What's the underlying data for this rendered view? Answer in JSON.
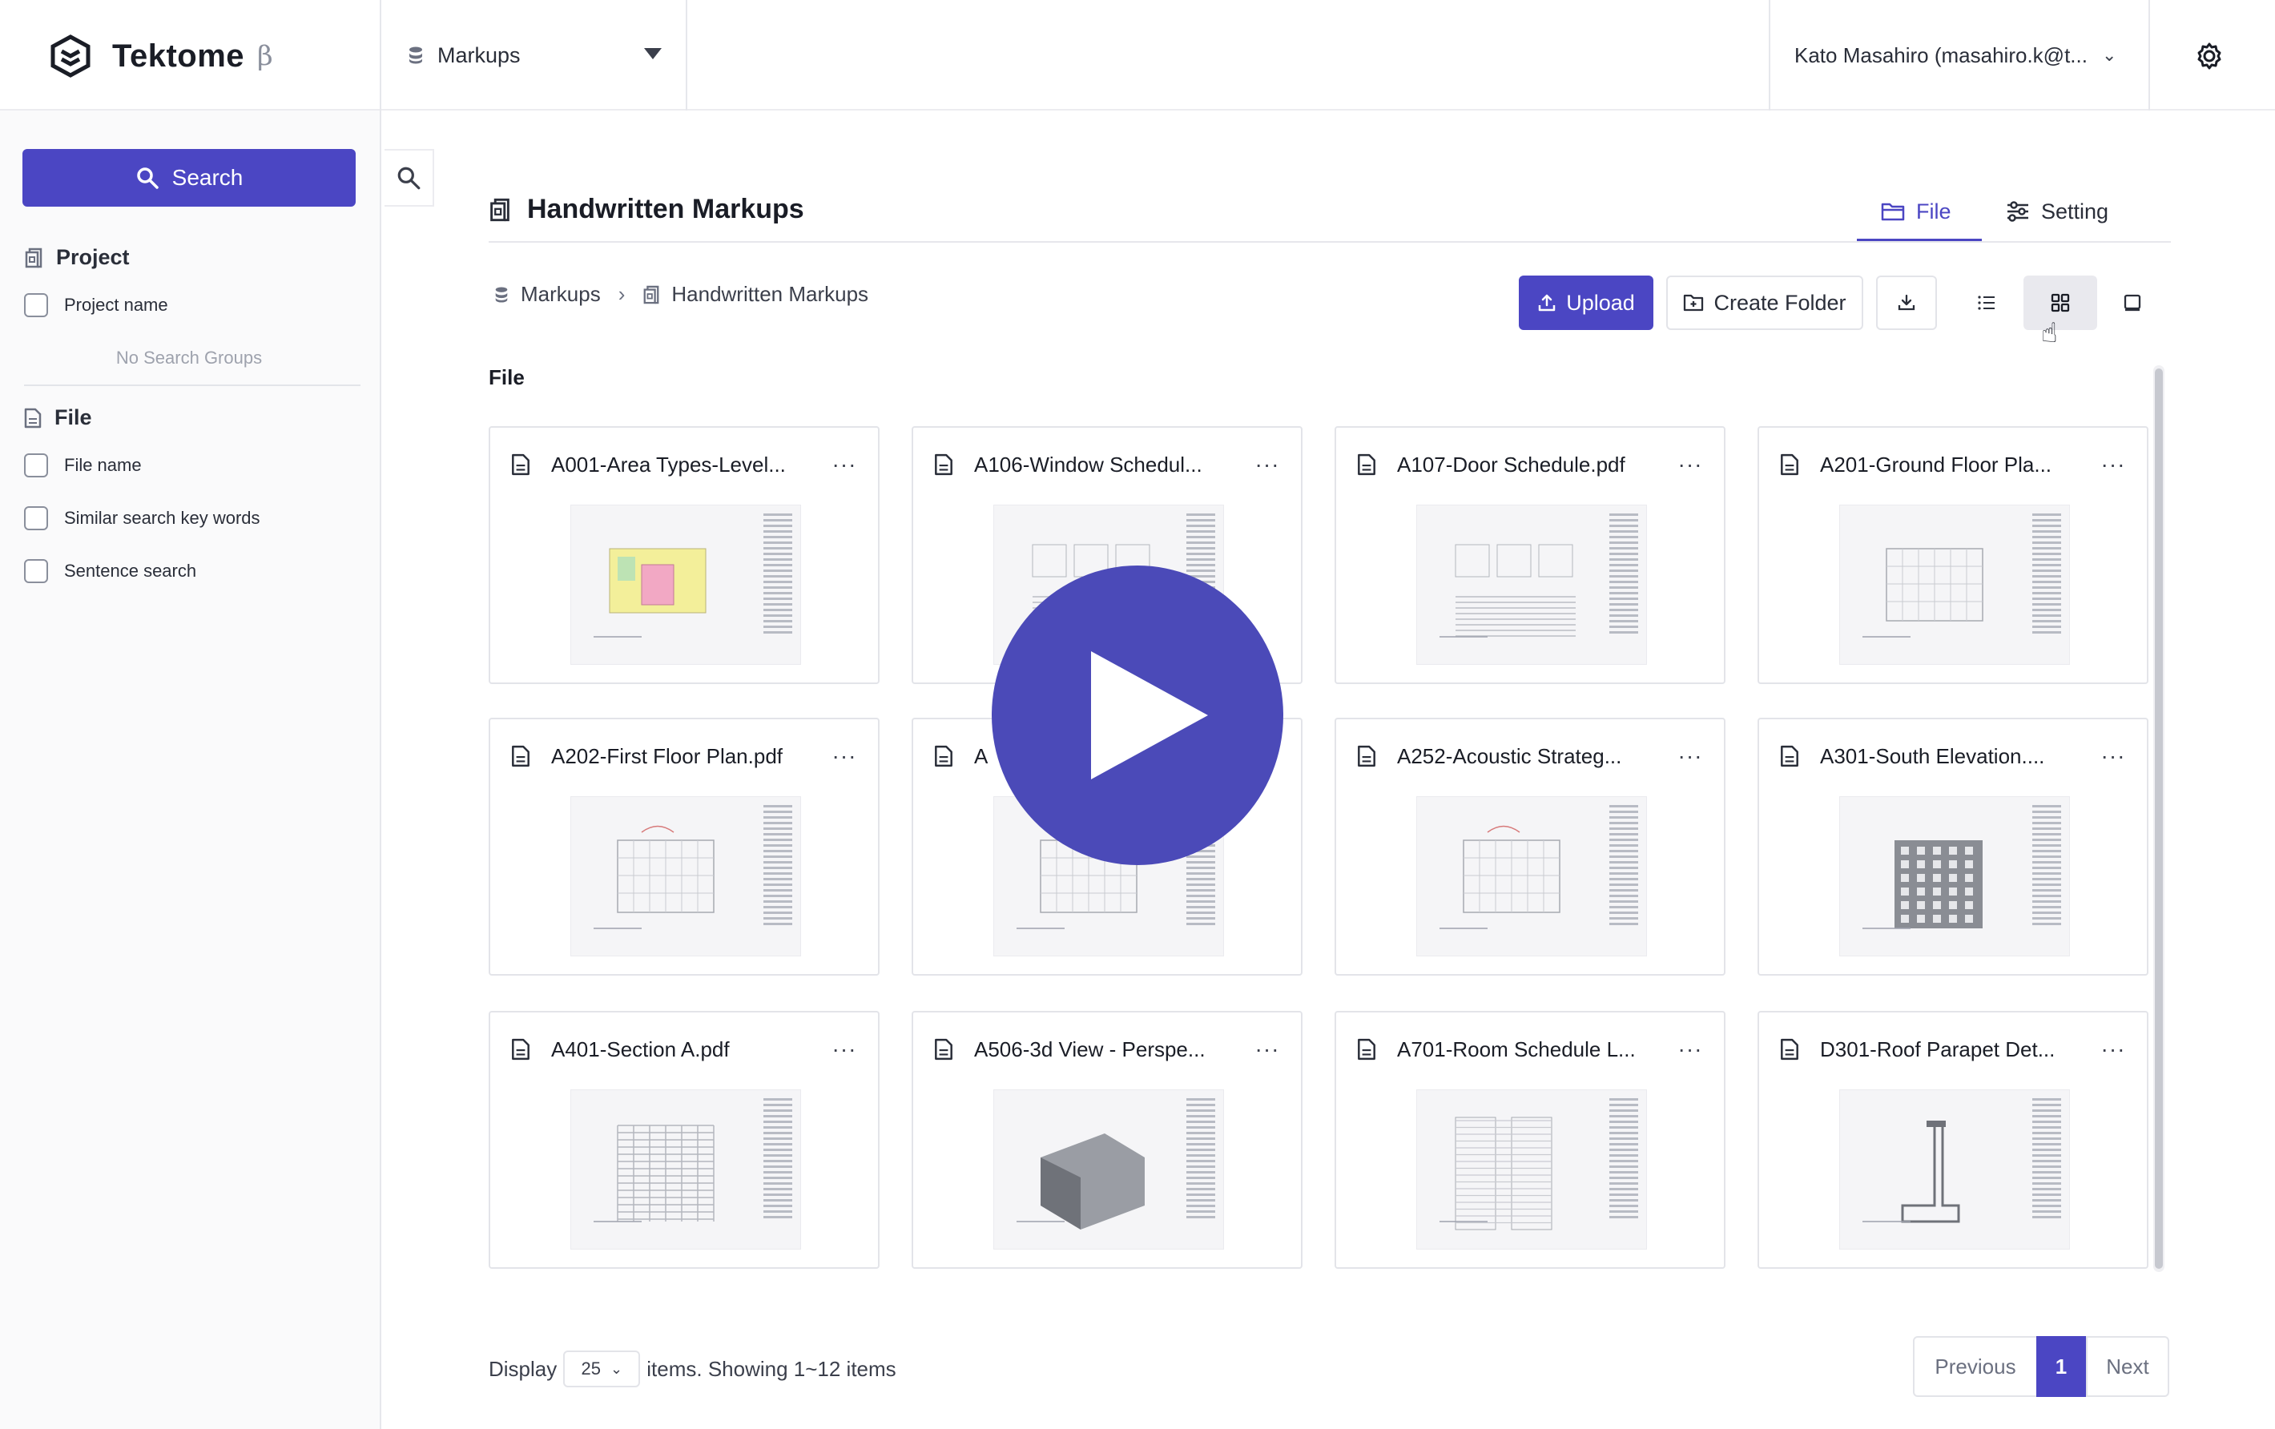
{
  "app": {
    "name": "Tektome",
    "beta": "β"
  },
  "header": {
    "database_label": "Markups",
    "user_label": "Kato Masahiro (masahiro.k@t..."
  },
  "sidebar": {
    "search_label": "Search",
    "project_section": "Project",
    "project_name_label": "Project name",
    "no_groups": "No Search Groups",
    "file_section": "File",
    "file_options": [
      "File name",
      "Similar search key words",
      "Sentence search"
    ]
  },
  "main": {
    "title": "Handwritten Markups",
    "tabs": {
      "file": "File",
      "setting": "Setting"
    },
    "breadcrumb": {
      "root": "Markups",
      "current": "Handwritten Markups"
    },
    "actions": {
      "upload": "Upload",
      "create_folder": "Create Folder"
    },
    "section_label": "File",
    "files": [
      "A001-Area Types-Level...",
      "A106-Window Schedul...",
      "A107-Door Schedule.pdf",
      "A201-Ground Floor Pla...",
      "A202-First Floor Plan.pdf",
      "A",
      "A252-Acoustic Strateg...",
      "A301-South Elevation....",
      "A401-Section A.pdf",
      "A506-3d View - Perspe...",
      "A701-Room Schedule L...",
      "D301-Roof Parapet Det..."
    ],
    "more_glyph": "···"
  },
  "footer": {
    "display_label": "Display",
    "page_size": "25",
    "showing": "items. Showing 1~12 items",
    "previous": "Previous",
    "current_page": "1",
    "next": "Next"
  },
  "colors": {
    "accent": "#4b46c3",
    "play_overlay": "#4b4ab8"
  }
}
